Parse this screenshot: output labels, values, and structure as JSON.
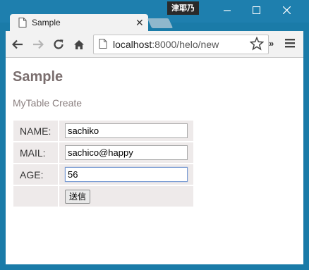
{
  "window": {
    "user_badge": "津耶乃",
    "minimize_icon": "minimize-icon",
    "maximize_icon": "maximize-icon",
    "close_icon": "close-icon"
  },
  "tab": {
    "title": "Sample",
    "close_glyph": "✕"
  },
  "toolbar": {
    "url_host": "localhost",
    "url_path": ":8000/helo/new",
    "overflow_glyph": "»"
  },
  "page": {
    "title": "Sample",
    "subtitle": "MyTable Create"
  },
  "form": {
    "rows": [
      {
        "label": "NAME:",
        "value": "sachiko"
      },
      {
        "label": "MAIL:",
        "value": "sachico@happy"
      },
      {
        "label": "AGE:",
        "value": "56"
      }
    ],
    "submit_label": "送信"
  },
  "colors": {
    "frame": "#1e7fae",
    "heading": "#7a6e6e",
    "cell_bg": "#eeeaea"
  }
}
